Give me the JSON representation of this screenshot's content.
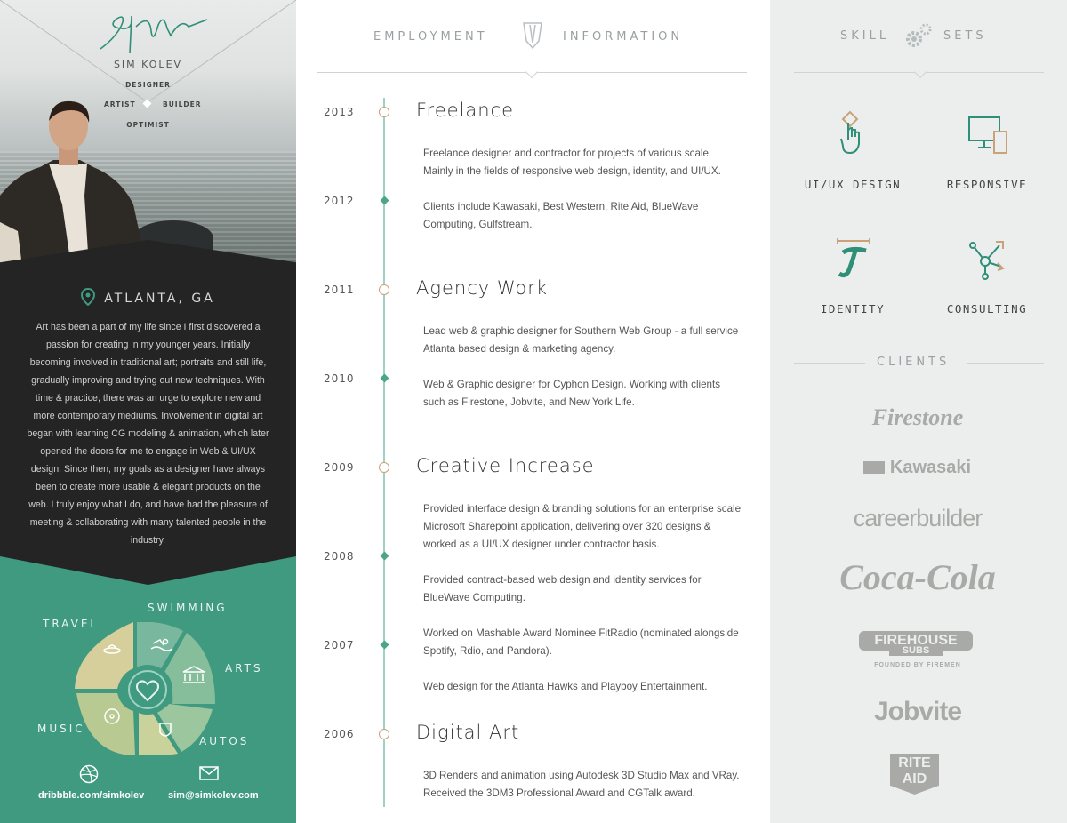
{
  "profile": {
    "name": "SIM KOLEV",
    "roles": {
      "top": "DESIGNER",
      "left": "ARTIST",
      "right": "BUILDER",
      "bottom": "OPTIMIST"
    },
    "location": "ATLANTA, GA",
    "bio": "Art has been a part of my life since I first discovered a passion for creating in my younger years. Initially becoming involved in traditional art; portraits and still life, gradually improving and trying out new techniques. With time & practice, there was an urge to explore new and more contemporary mediums. Involvement in digital art began with learning CG modeling & animation, which later opened the doors for me to engage in Web & UI/UX design. Since then, my goals as a designer have always been to create more usable & elegant products on the web. I truly enjoy what I do, and have had the pleasure of meeting & collaborating with many talented people in the industry."
  },
  "hobbies": {
    "travel": "TRAVEL",
    "swimming": "SWIMMING",
    "arts": "ARTS",
    "music": "MUSIC",
    "autos": "AUTOS"
  },
  "contacts": {
    "dribbble_prefix": "dribbble.com/",
    "dribbble_user": "simkolev",
    "email": "sim@simkolev.com"
  },
  "employment": {
    "heading_left": "EMPLOYMENT",
    "heading_right": "INFORMATION",
    "years": [
      "2013",
      "2012",
      "2011",
      "2010",
      "2009",
      "2008",
      "2007",
      "2006"
    ],
    "jobs": [
      {
        "title": "Freelance"
      },
      {
        "title": "Agency Work"
      },
      {
        "title": "Creative Increase"
      },
      {
        "title": "Digital Art"
      }
    ],
    "descriptions": [
      "Freelance designer and contractor for projects of various scale. Mainly in the fields of responsive web design, identity, and UI/UX.",
      "Clients include Kawasaki, Best Western, Rite Aid, BlueWave Computing, Gulfstream.",
      "Lead web & graphic designer for Southern Web Group - a full service Atlanta based design & marketing agency.",
      "Web & Graphic designer for Cyphon Design. Working with clients such as Firestone, Jobvite, and New York Life.",
      "Provided interface design & branding solutions for an enterprise scale Microsoft Sharepoint application, delivering over 320 designs & worked as a UI/UX designer under contractor basis.",
      "Provided contract-based web design and identity services for BlueWave Computing.",
      "Worked on Mashable Award Nominee FitRadio (nominated alongside Spotify, Rdio, and Pandora).",
      "Web design for the Atlanta Hawks and Playboy Entertainment.",
      "3D Renders and animation using Autodesk 3D Studio Max and VRay. Received the 3DM3 Professional Award and CGTalk award."
    ]
  },
  "skills": {
    "heading_left": "SKILL",
    "heading_right": "SETS",
    "items": [
      "UI/UX DESIGN",
      "RESPONSIVE",
      "IDENTITY",
      "CONSULTING"
    ]
  },
  "clients": {
    "heading": "CLIENTS",
    "logos": [
      "Firestone",
      "Kawasaki",
      "careerbuilder",
      "Coca-Cola",
      "FIREHOUSE",
      "SUBS",
      "FOUNDED BY FIREMEN",
      "Jobvite",
      "RITE",
      "AID"
    ]
  },
  "colors": {
    "accent_green": "#3f9a80",
    "accent_tan": "#c9a27a",
    "dark": "#242424"
  }
}
